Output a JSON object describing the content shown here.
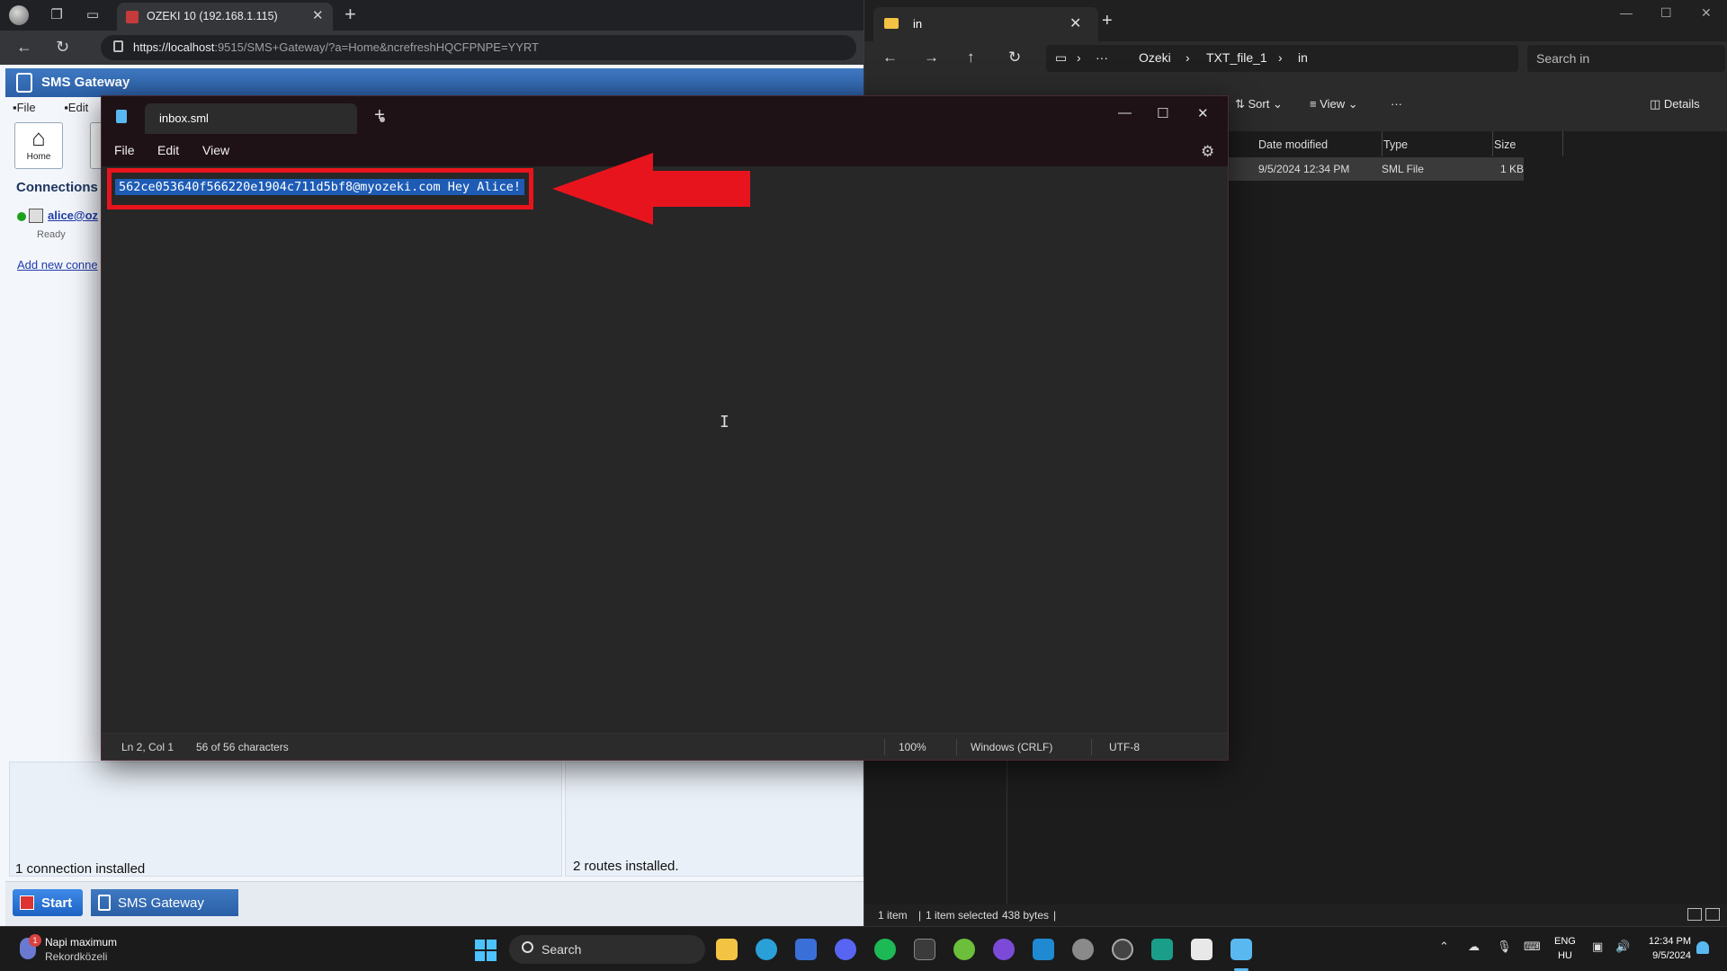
{
  "browser": {
    "tab_title": "OZEKI 10 (192.168.1.115)",
    "url_host": "https://localhost",
    "url_rest": ":9515/SMS+Gateway/?a=Home&ncrefreshHQCFPNPE=YYRT"
  },
  "sms_gateway": {
    "title": "SMS Gateway",
    "menu": [
      "File",
      "Edit"
    ],
    "home_label": "Home",
    "connections_title": "Connections",
    "connection_name": "alice@oz",
    "connection_status": "Ready",
    "add_connection": "Add new conne",
    "connections_count": "1 connection installed",
    "routes_count": "2 routes installed.",
    "start_label": "Start",
    "taskbar_app": "SMS Gateway"
  },
  "explorer": {
    "tab_title": "in",
    "breadcrumbs": [
      "Ozeki",
      "TXT_file_1",
      "in"
    ],
    "search_placeholder": "Search in",
    "toolbar": {
      "sort": "Sort",
      "view": "View",
      "details": "Details"
    },
    "columns": [
      "Date modified",
      "Type",
      "Size"
    ],
    "file": {
      "date": "9/5/2024 12:34 PM",
      "type": "SML File",
      "size": "1 KB"
    },
    "status": {
      "items": "1 item",
      "selected": "1 item selected",
      "bytes": "438 bytes"
    }
  },
  "notepad": {
    "tab_title": "inbox.sml",
    "menu": [
      "File",
      "Edit",
      "View"
    ],
    "content_line": "562ce053640f566220e1904c711d5bf8@myozeki.com Hey Alice!",
    "status": {
      "position": "Ln 2, Col 1",
      "characters": "56 of 56 characters",
      "zoom": "100%",
      "line_ending": "Windows (CRLF)",
      "encoding": "UTF-8"
    }
  },
  "taskbar": {
    "weather_line1": "Napi maximum",
    "weather_line2": "Rekordközeli",
    "weather_badge": "1",
    "search_label": "Search",
    "lang_line1": "ENG",
    "lang_line2": "HU",
    "time": "12:34 PM",
    "date": "9/5/2024"
  },
  "colors": {
    "highlight_box": "#e8141d",
    "selection": "#1d5bb5",
    "ozeki_blue": "#2a5fa6"
  }
}
